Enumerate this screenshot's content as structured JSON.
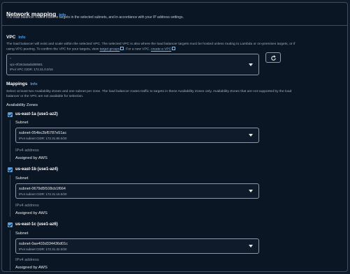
{
  "section": {
    "title": "Network mapping",
    "info": "Info",
    "description": "The load balancer routes traffic to targets in the selected subnets, and in accordance with your IP address settings."
  },
  "vpc": {
    "label": "VPC",
    "info": "Info",
    "description_line1": "The load balancer will exist and scale within the selected VPC. The selected VPC is also where the load balancer targets must be hosted unless routing to Lambda or on-premises targets, or if",
    "description_pre": "using VPC peering. To confirm the VPC for your targets, view",
    "link_target_groups": "target groups",
    "description_mid": ". For a new VPC,",
    "link_create_vpc": "create a VPC",
    "selected_name": "-",
    "selected_id": "vpc-0f19cba5abd80581",
    "selected_cidr": "IPv4 VPC CIDR: 172.31.0.0/16"
  },
  "mappings": {
    "label": "Mappings",
    "info": "Info",
    "description_line1": "Select at least two Availability Zones and one subnet per zone. The load balancer routes traffic to targets in these Availability Zones only. Availability Zones that are not supported by the load",
    "description_line2": "balancer or the VPC are not available for selection.",
    "az_heading": "Availability Zones",
    "zones": [
      {
        "name": "us-east-1a (use1-az2)",
        "subnet_label": "Subnet",
        "subnet_id": "subnet-054bc2bf5787e51ac",
        "subnet_cidr": "IPv4 subnet CIDR: 172.31.80.0/20",
        "ipv4_label": "IPv4 address",
        "ipv4_value": "Assigned by AWS"
      },
      {
        "name": "us-east-1b (use1-az4)",
        "subnet_label": "Subnet",
        "subnet_id": "subnet-0679d5f108cb1f664",
        "subnet_cidr": "IPv4 subnet CIDR: 172.31.16.0/20",
        "ipv4_label": "IPv4 address",
        "ipv4_value": "Assigned by AWS"
      },
      {
        "name": "us-east-1c (use1-az6)",
        "subnet_label": "Subnet",
        "subnet_id": "subnet-0ae403d334436d01c",
        "subnet_cidr": "IPv4 subnet CIDR: 172.31.32.0/20",
        "ipv4_label": "IPv4 address",
        "ipv4_value": "Assigned by AWS"
      }
    ]
  },
  "icons": {
    "refresh": "refresh-icon",
    "external": "external-link-icon",
    "caret": "caret-down-icon",
    "checkbox": "checkbox-checked-icon"
  },
  "colors": {
    "background": "#0f1b2a",
    "panel": "#0b1624",
    "accent": "#539fe5",
    "link": "#89bdee"
  }
}
